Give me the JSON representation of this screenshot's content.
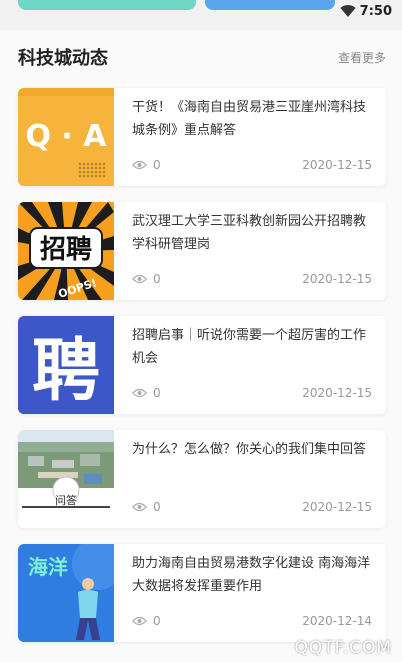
{
  "status_bar": {
    "time": "7:50",
    "wifi_icon": "wifi-icon"
  },
  "section": {
    "title": "科技城动态",
    "more": "查看更多"
  },
  "news": [
    {
      "title": "干货！《海南自由贸易港三亚崖州湾科技城条例》重点解答",
      "views": "0",
      "date": "2020-12-15",
      "thumb": {
        "type": "qa",
        "text": "Q · A",
        "bg": "#f6b43c"
      }
    },
    {
      "title": "武汉理工大学三亚科教创新园公开招聘教学科研管理岗",
      "views": "0",
      "date": "2020-12-15",
      "thumb": {
        "type": "comic",
        "text": "招聘",
        "badge": "OOPS!",
        "bg": "#f7a020"
      }
    },
    {
      "title": "招聘启事｜听说你需要一个超厉害的工作机会",
      "views": "0",
      "date": "2020-12-15",
      "thumb": {
        "type": "pin",
        "text": "聘",
        "bg": "#3d56c8"
      }
    },
    {
      "title": "为什么？怎么做？你关心的我们集中回答",
      "views": "0",
      "date": "2020-12-15",
      "thumb": {
        "type": "photo",
        "text": "问答"
      }
    },
    {
      "title": "助力海南自由贸易港数字化建设 南海海洋大数据将发挥重要作用",
      "views": "0",
      "date": "2020-12-14",
      "thumb": {
        "type": "ocean",
        "text": "海洋",
        "bg": "#2f7de0"
      }
    }
  ],
  "watermark": "QQTF.COM"
}
